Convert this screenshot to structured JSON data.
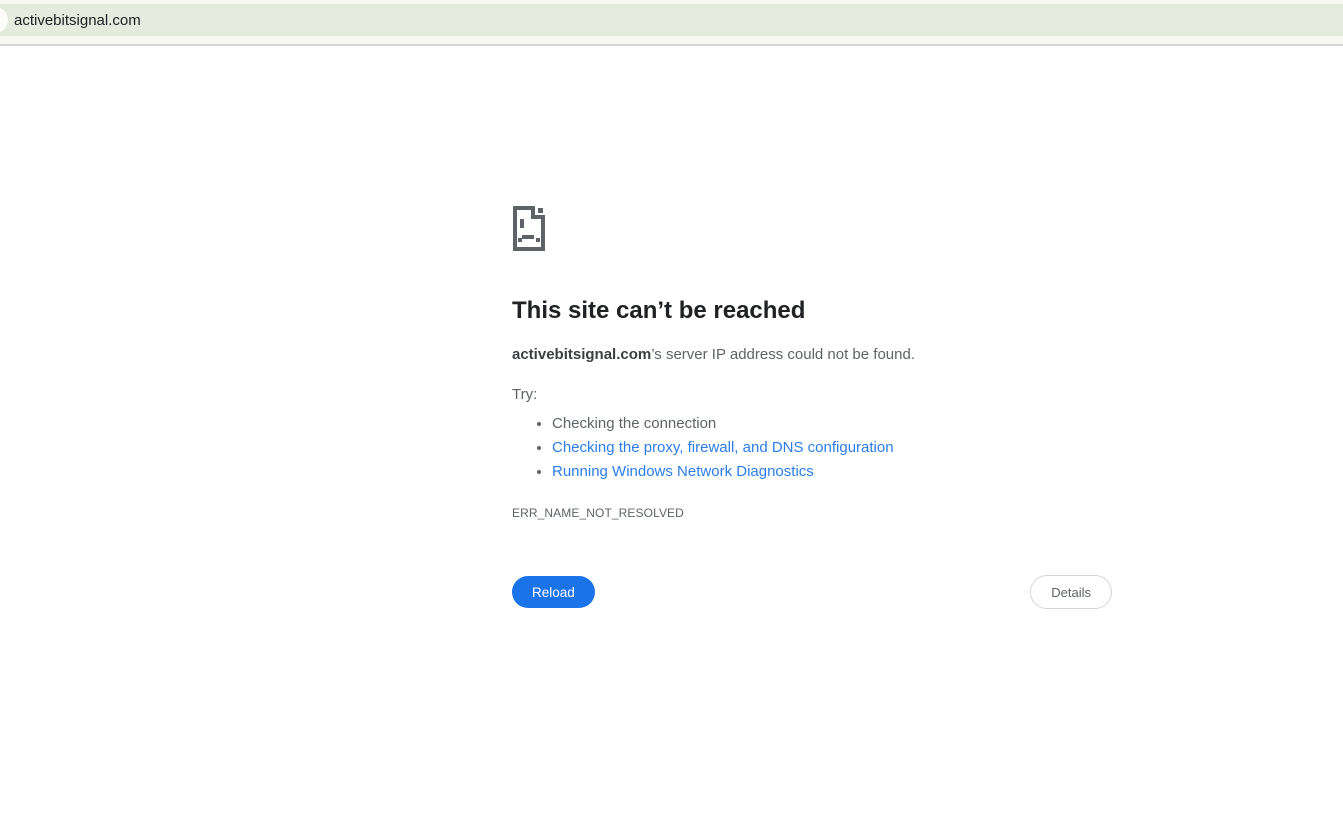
{
  "topbar": {
    "url_text": "activebitsignal.com"
  },
  "error_page": {
    "title": "This site can’t be reached",
    "subtitle_domain": "activebitsignal.com",
    "subtitle_rest": "’s server IP address could not be found.",
    "try_label": "Try:",
    "suggestions": [
      {
        "label": "Checking the connection",
        "link": false
      },
      {
        "label": "Checking the proxy, firewall, and DNS configuration",
        "link": true
      },
      {
        "label": "Running Windows Network Diagnostics",
        "link": true
      }
    ],
    "error_code": "ERR_NAME_NOT_RESOLVED",
    "reload_label": "Reload",
    "details_label": "Details"
  },
  "colors": {
    "topbar_background": "#e5ecdd",
    "topbar_strip": "#f7f9f0",
    "divider": "#d6d7d2",
    "heading_text": "#202124",
    "body_text": "#5f6368",
    "link_blue": "#2b7de9",
    "button_blue": "#1a73e8",
    "icon_gray": "#5f6368"
  }
}
